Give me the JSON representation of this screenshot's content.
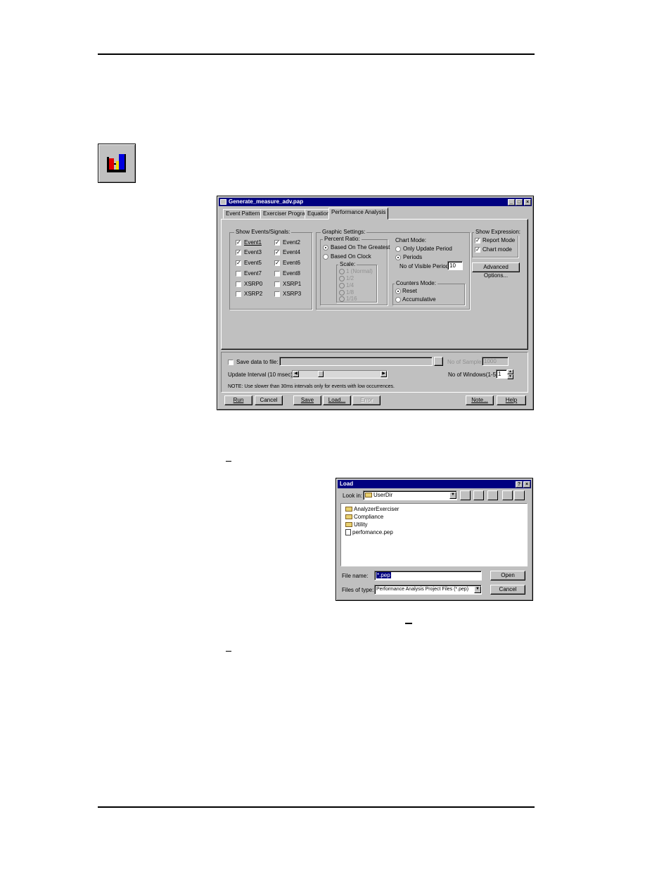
{
  "main_window": {
    "title": "Generate_measure_adv.pap",
    "tabs": [
      "Event Patterns",
      "Exerciser Program",
      "Equation",
      "Performance Analysis"
    ],
    "show_events": {
      "label": "Show Events/Signals:",
      "items": [
        {
          "label": "Event1",
          "checked": true
        },
        {
          "label": "Event2",
          "checked": true
        },
        {
          "label": "Event3",
          "checked": true
        },
        {
          "label": "Event4",
          "checked": true
        },
        {
          "label": "Event5",
          "checked": true
        },
        {
          "label": "Event6",
          "checked": true
        },
        {
          "label": "Event7",
          "checked": false
        },
        {
          "label": "Event8",
          "checked": false
        },
        {
          "label": "XSRP0",
          "checked": false
        },
        {
          "label": "XSRP1",
          "checked": false
        },
        {
          "label": "XSRP2",
          "checked": false
        },
        {
          "label": "XSRP3",
          "checked": false
        }
      ]
    },
    "graphic_settings": {
      "label": "Graphic Settings:",
      "percent_ratio_label": "Percent Ratio:",
      "based_greatest": "Based On The Greatest",
      "based_clock": "Based On Clock",
      "scale_label": "Scale:",
      "scale_items": [
        "1 (Normal)",
        "1/2",
        "1/4",
        "1/8",
        "1/16"
      ]
    },
    "chart_mode": {
      "label": "Chart Mode:",
      "only_update": "Only Update Period",
      "periods": "Periods",
      "visible_periods_label": "No of Visible Periods",
      "visible_periods_value": "10"
    },
    "counters_mode": {
      "label": "Counters Mode:",
      "reset": "Reset",
      "accumulative": "Accumulative"
    },
    "show_expression": {
      "label": "Show Expression:",
      "report_mode": "Report Mode",
      "chart_mode": "Chart mode"
    },
    "advanced_options": "Advanced Options...",
    "save_data_label": "Save data to file:",
    "samples_label": "No of Samples:",
    "samples_value": "1000",
    "update_interval_label": "Update Interval (10 msec):",
    "windows_label": "No of Windows(1-5) :",
    "windows_value": "1",
    "note_text": "NOTE: Use slower than 30ms intervals only for events with low occurrences.",
    "buttons": {
      "run": "Run",
      "cancel": "Cancel",
      "save": "Save",
      "load": "Load...",
      "error": "Error",
      "note": "Note...",
      "help": "Help"
    }
  },
  "load_dialog": {
    "title": "Load",
    "look_in_label": "Look in:",
    "look_in_value": "UserDir",
    "files": [
      {
        "name": "AnalyzerExerciser",
        "type": "folder"
      },
      {
        "name": "Compliance",
        "type": "folder"
      },
      {
        "name": "Utility",
        "type": "folder"
      },
      {
        "name": "perfomance.pep",
        "type": "file"
      }
    ],
    "file_name_label": "File name:",
    "file_name_value": "*.pep",
    "files_of_type_label": "Files of type:",
    "files_of_type_value": "Performance Analysis Project Files (*.pep)",
    "open_button": "Open",
    "cancel_button": "Cancel"
  }
}
